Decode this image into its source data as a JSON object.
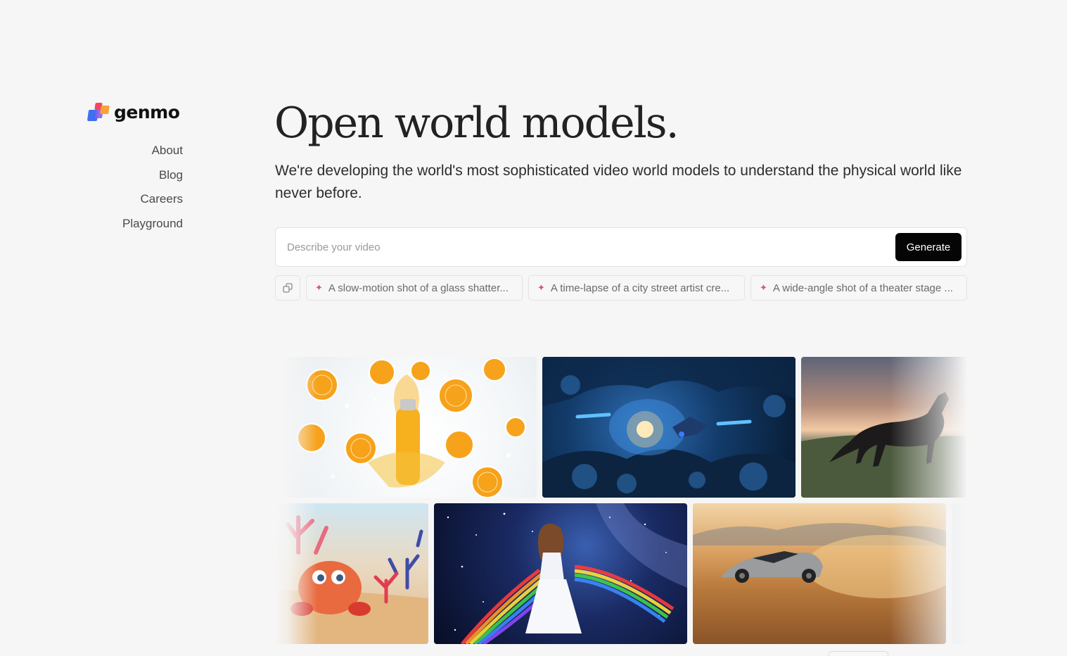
{
  "brand": {
    "name": "genmo"
  },
  "nav": {
    "items": [
      {
        "label": "About"
      },
      {
        "label": "Blog"
      },
      {
        "label": "Careers"
      },
      {
        "label": "Playground"
      }
    ]
  },
  "hero": {
    "headline": "Open world models.",
    "subtitle": "We're developing the world's most sophisticated video world models to understand the physical world like never before."
  },
  "prompt": {
    "placeholder": "Describe your video",
    "value": "",
    "generate_label": "Generate"
  },
  "suggestions": [
    {
      "icon": "sparkle-icon",
      "text": "A slow-motion shot of a glass shatter..."
    },
    {
      "icon": "sparkle-icon",
      "text": "A time-lapse of a city street artist cre..."
    },
    {
      "icon": "sparkle-icon",
      "text": "A wide-angle shot of a theater stage ..."
    }
  ],
  "gallery": {
    "tiles": [
      {
        "subject": "orange juice splash"
      },
      {
        "subject": "underwater cave diver"
      },
      {
        "subject": "galloping horse at sunset"
      },
      {
        "subject": "cartoon crab on beach"
      },
      {
        "subject": "woman with rainbow in space"
      },
      {
        "subject": "sports car drifting in desert"
      }
    ]
  },
  "colors": {
    "background": "#f6f6f6",
    "button_bg": "#050505",
    "accent_sparkle": "#e2556b"
  }
}
